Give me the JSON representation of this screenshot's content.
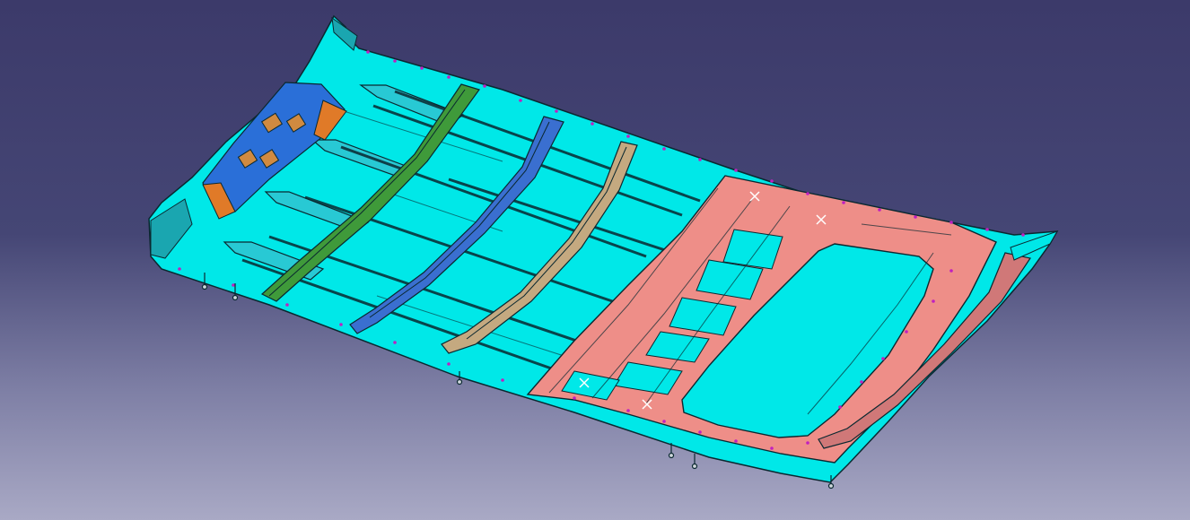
{
  "viewer": {
    "background_top": "#3c3a6a",
    "background_bottom": "#a9a9c5"
  },
  "model": {
    "part_colors": {
      "roof_panel": "#00e8e8",
      "front_header": "#2a6fd8",
      "bow_green": "#3f9a3a",
      "bow_blue": "#3a6fd0",
      "bow_tan": "#c4a980",
      "rear_reinforcement": "#ee8e88",
      "rear_header": "#d07878",
      "bracket_orange": "#e07a28",
      "edge_line": "#0a2830",
      "fastener_points": "#c020c0"
    },
    "parts": [
      "roof-panel",
      "front-header-bracket",
      "roof-bow-1",
      "roof-bow-2",
      "roof-bow-3",
      "rear-reinforcement-frame",
      "rear-header-rail"
    ]
  }
}
